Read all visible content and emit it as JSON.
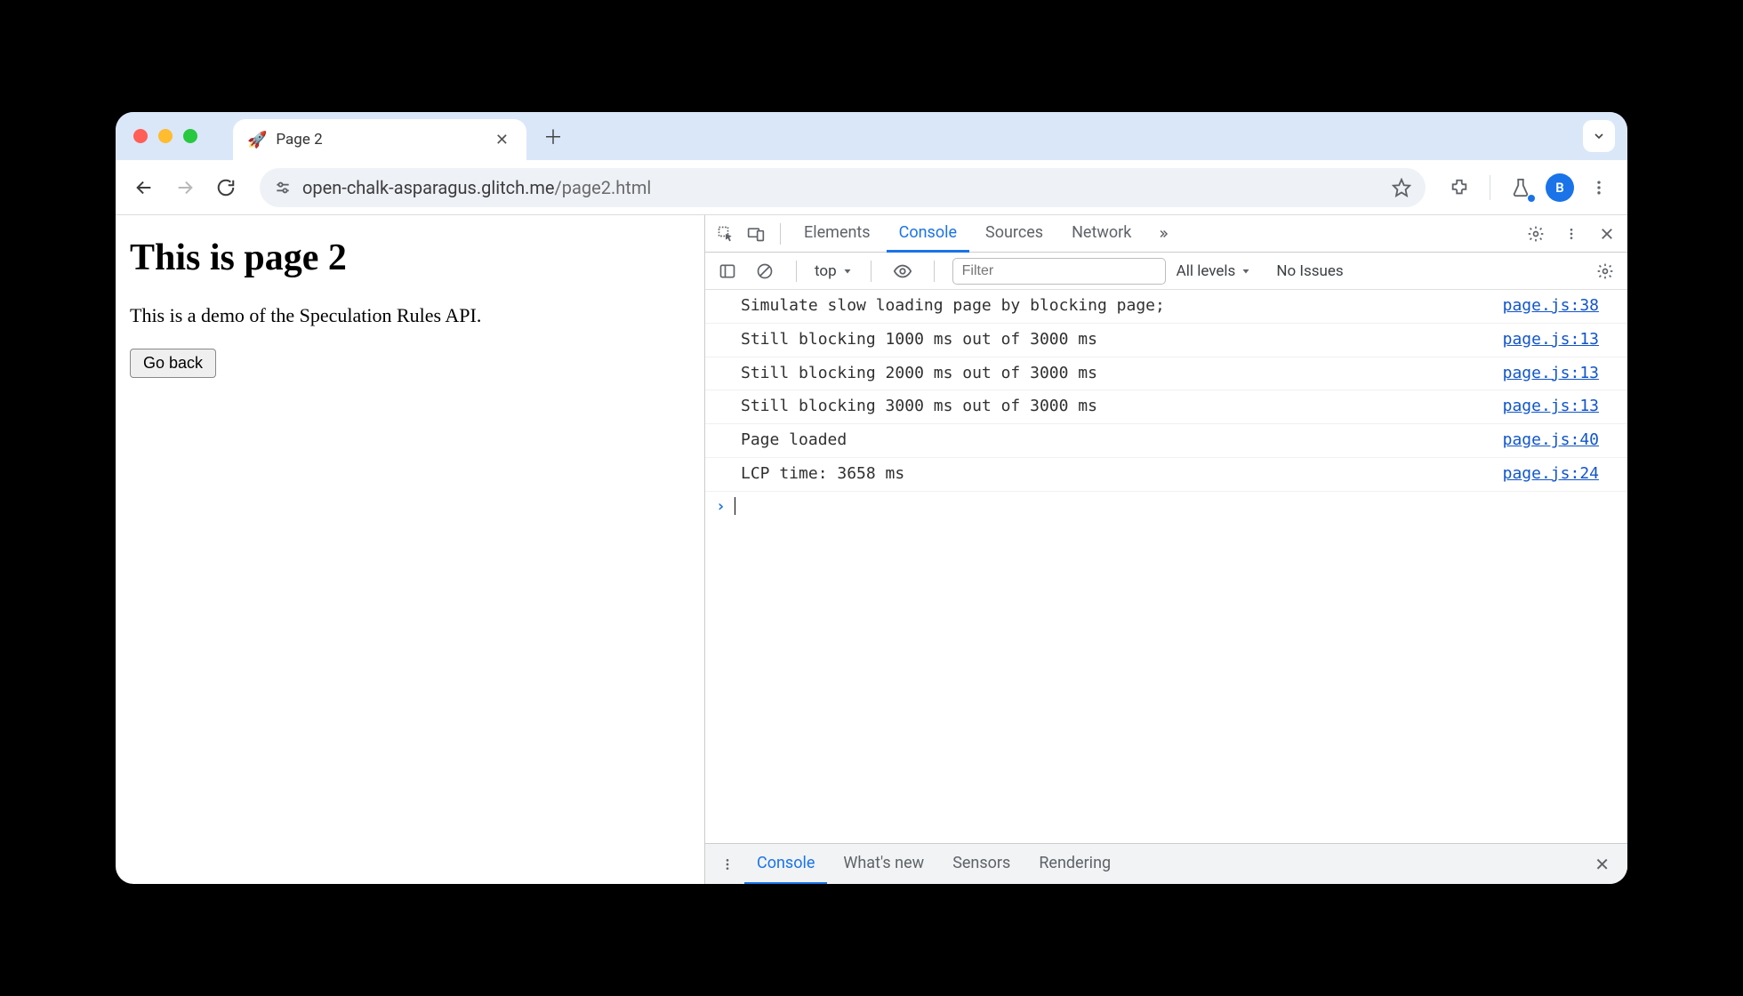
{
  "chrome": {
    "tab": {
      "favicon": "🚀",
      "title": "Page 2"
    },
    "url_host": "open-chalk-asparagus.glitch.me",
    "url_path": "/page2.html",
    "avatar_letter": "B"
  },
  "page": {
    "heading": "This is page 2",
    "paragraph": "This is a demo of the Speculation Rules API.",
    "button": "Go back"
  },
  "devtools": {
    "tabs": [
      "Elements",
      "Console",
      "Sources",
      "Network"
    ],
    "active_tab": "Console",
    "console_bar": {
      "context": "top",
      "filter_placeholder": "Filter",
      "levels": "All levels",
      "issues": "No Issues"
    },
    "logs": [
      {
        "msg": "Simulate slow loading page by blocking page;",
        "src": "page.js:38"
      },
      {
        "msg": "Still blocking 1000 ms out of 3000 ms",
        "src": "page.js:13"
      },
      {
        "msg": "Still blocking 2000 ms out of 3000 ms",
        "src": "page.js:13"
      },
      {
        "msg": "Still blocking 3000 ms out of 3000 ms",
        "src": "page.js:13"
      },
      {
        "msg": "Page loaded",
        "src": "page.js:40"
      },
      {
        "msg": "LCP time: 3658 ms",
        "src": "page.js:24"
      }
    ],
    "drawer_tabs": [
      "Console",
      "What's new",
      "Sensors",
      "Rendering"
    ],
    "drawer_active": "Console"
  }
}
